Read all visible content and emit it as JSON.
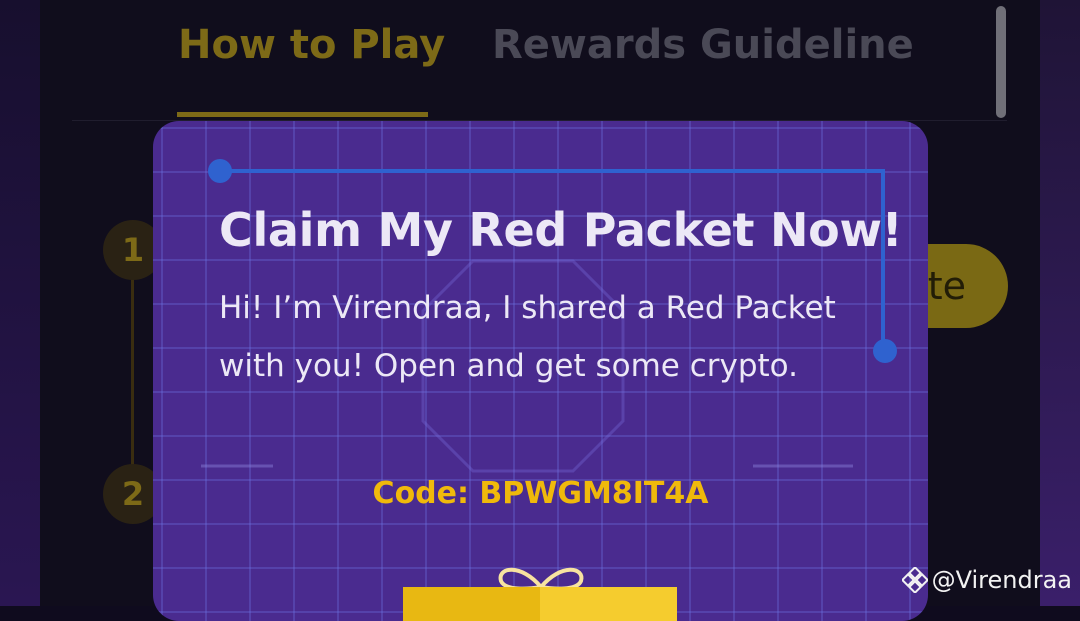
{
  "tabs": [
    {
      "label": "How to Play",
      "active": true
    },
    {
      "label": "Rewards Guideline",
      "active": false
    }
  ],
  "steps": [
    "1",
    "2"
  ],
  "invite_button_fragment": "te",
  "modal": {
    "title": "Claim My Red Packet Now!",
    "message": "Hi! I’m Virendraa, I shared a Red Packet with you! Open and get some crypto.",
    "code_text": "Code: BPWGM8IT4A",
    "gift_icon": "gift-box-icon"
  },
  "watermark": {
    "icon": "binance-logo-icon",
    "text": "@Virendraa"
  },
  "colors": {
    "accent": "#f0b90b",
    "modal_background": "#4a2b8f",
    "page_background": "#100d1c"
  }
}
